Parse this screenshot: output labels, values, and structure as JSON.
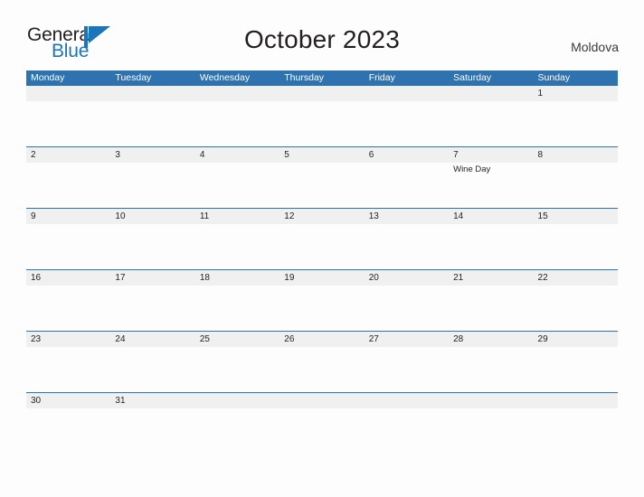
{
  "brand": {
    "name_part1": "General",
    "name_part2": "Blue",
    "flag_icon": "blue-flag-icon",
    "color_dark": "#231f20",
    "color_blue": "#1b75bb"
  },
  "header": {
    "title": "October 2023",
    "country": "Moldova"
  },
  "calendar": {
    "accent_color": "#2e72b0",
    "daynum_band_color": "#f0f0f0",
    "weekdays": [
      "Monday",
      "Tuesday",
      "Wednesday",
      "Thursday",
      "Friday",
      "Saturday",
      "Sunday"
    ],
    "weeks": [
      {
        "days": [
          {
            "num": "",
            "events": []
          },
          {
            "num": "",
            "events": []
          },
          {
            "num": "",
            "events": []
          },
          {
            "num": "",
            "events": []
          },
          {
            "num": "",
            "events": []
          },
          {
            "num": "",
            "events": []
          },
          {
            "num": "1",
            "events": []
          }
        ]
      },
      {
        "days": [
          {
            "num": "2",
            "events": []
          },
          {
            "num": "3",
            "events": []
          },
          {
            "num": "4",
            "events": []
          },
          {
            "num": "5",
            "events": []
          },
          {
            "num": "6",
            "events": []
          },
          {
            "num": "7",
            "events": [
              "Wine Day"
            ]
          },
          {
            "num": "8",
            "events": []
          }
        ]
      },
      {
        "days": [
          {
            "num": "9",
            "events": []
          },
          {
            "num": "10",
            "events": []
          },
          {
            "num": "11",
            "events": []
          },
          {
            "num": "12",
            "events": []
          },
          {
            "num": "13",
            "events": []
          },
          {
            "num": "14",
            "events": []
          },
          {
            "num": "15",
            "events": []
          }
        ]
      },
      {
        "days": [
          {
            "num": "16",
            "events": []
          },
          {
            "num": "17",
            "events": []
          },
          {
            "num": "18",
            "events": []
          },
          {
            "num": "19",
            "events": []
          },
          {
            "num": "20",
            "events": []
          },
          {
            "num": "21",
            "events": []
          },
          {
            "num": "22",
            "events": []
          }
        ]
      },
      {
        "days": [
          {
            "num": "23",
            "events": []
          },
          {
            "num": "24",
            "events": []
          },
          {
            "num": "25",
            "events": []
          },
          {
            "num": "26",
            "events": []
          },
          {
            "num": "27",
            "events": []
          },
          {
            "num": "28",
            "events": []
          },
          {
            "num": "29",
            "events": []
          }
        ]
      },
      {
        "days": [
          {
            "num": "30",
            "events": []
          },
          {
            "num": "31",
            "events": []
          },
          {
            "num": "",
            "events": []
          },
          {
            "num": "",
            "events": []
          },
          {
            "num": "",
            "events": []
          },
          {
            "num": "",
            "events": []
          },
          {
            "num": "",
            "events": []
          }
        ]
      }
    ]
  }
}
